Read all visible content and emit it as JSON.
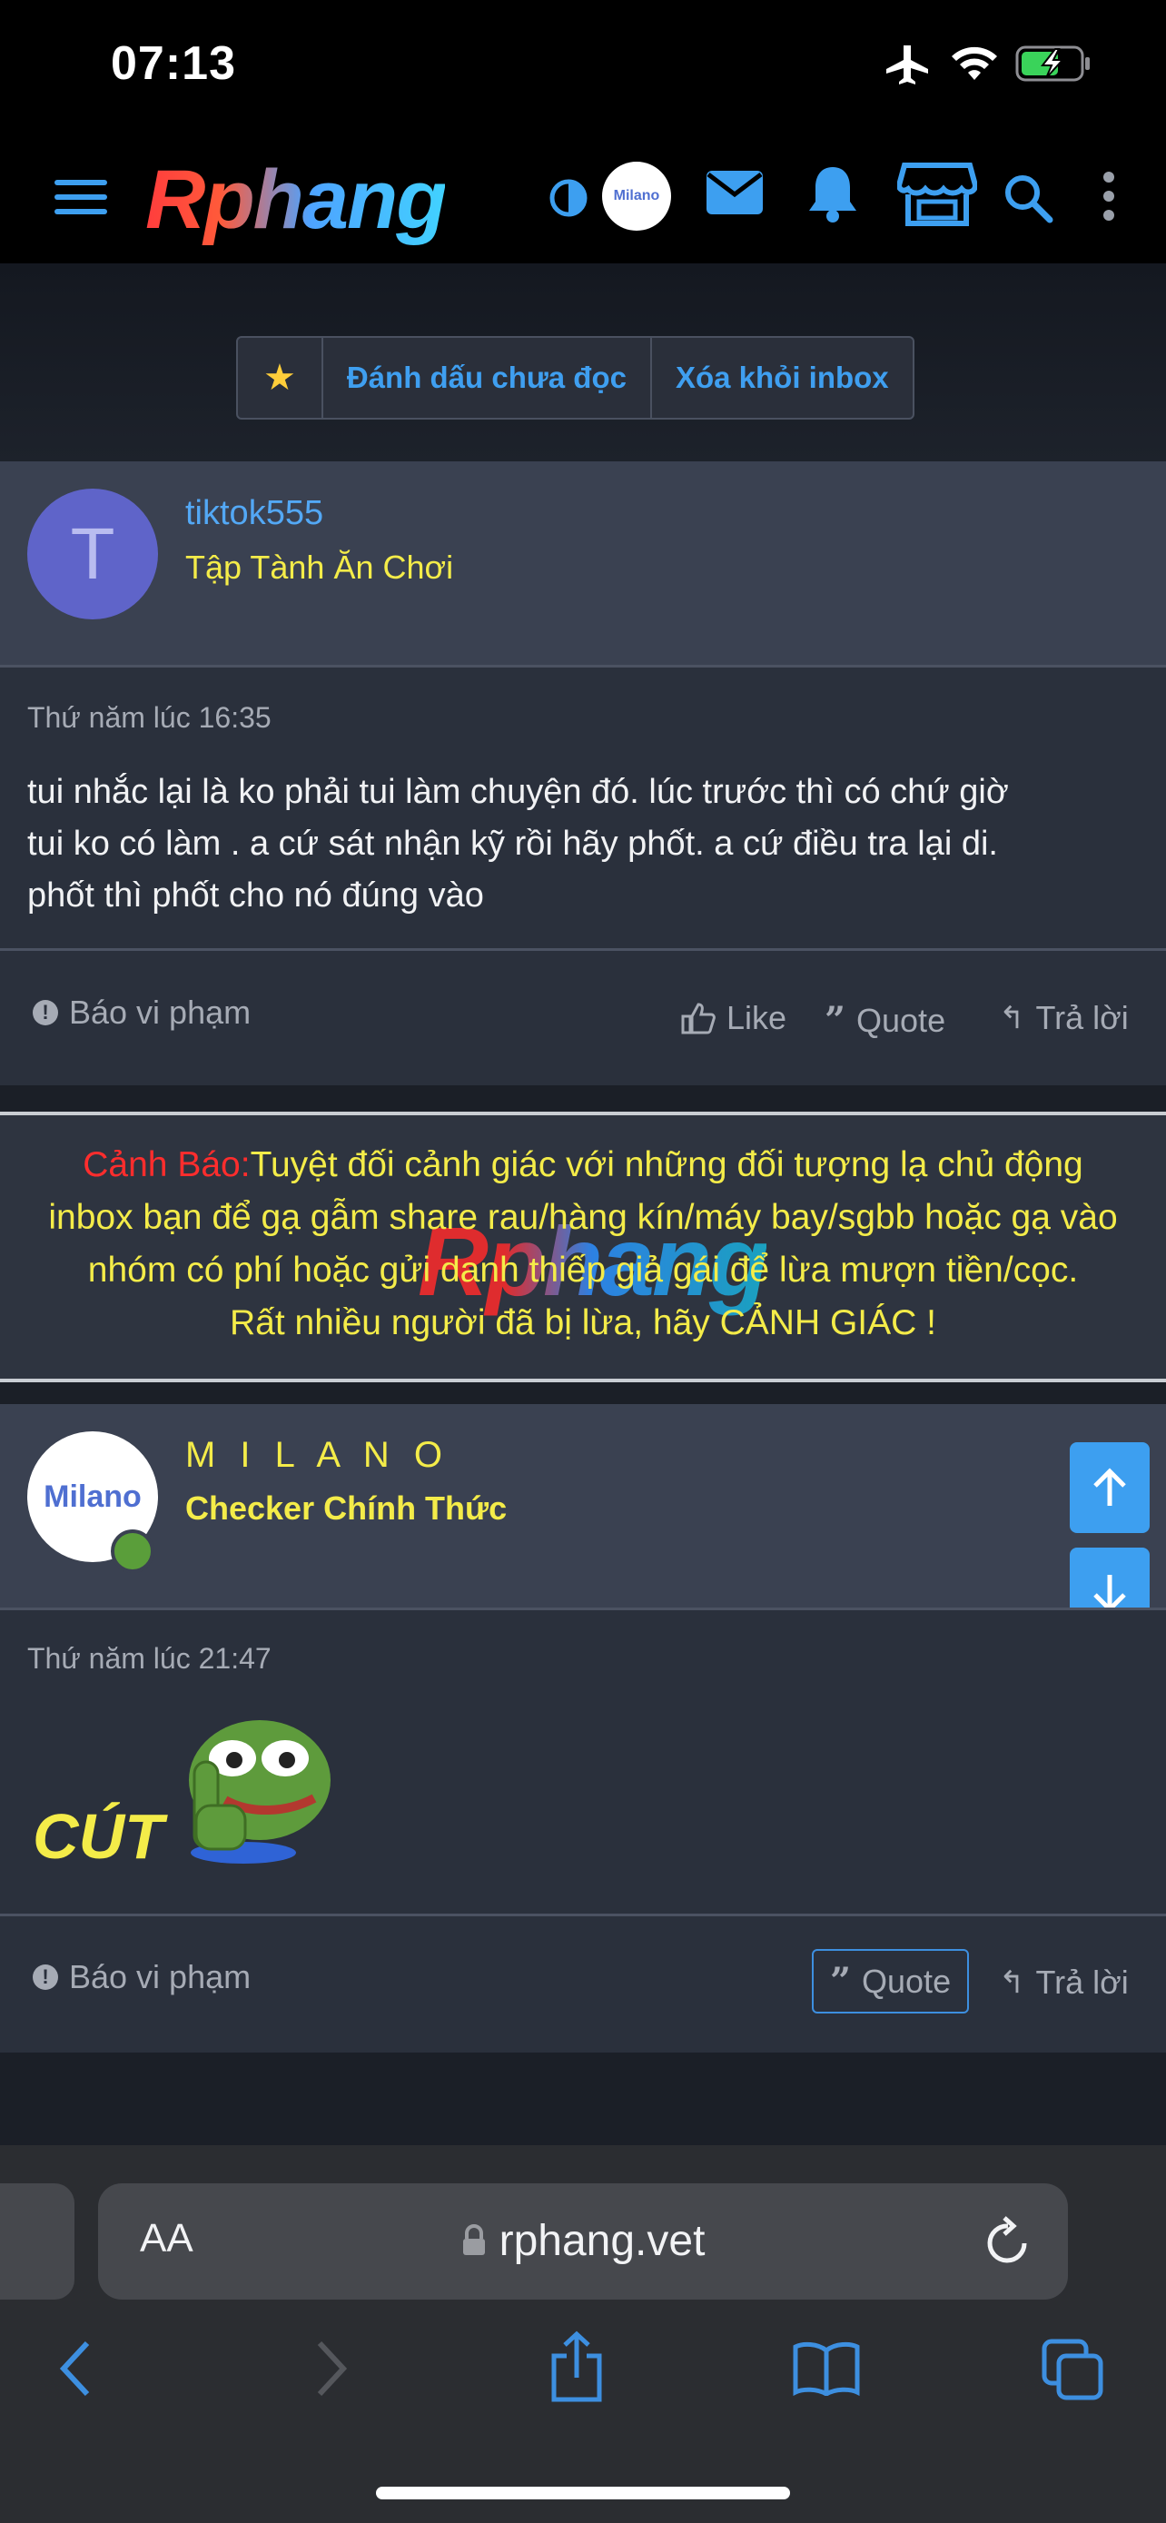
{
  "status": {
    "time": "07:13"
  },
  "header": {
    "logo_text": "Rphang",
    "avatar_text": "Milano"
  },
  "toolbar": {
    "mark_unread": "Đánh dấu chưa đọc",
    "remove_inbox": "Xóa khỏi inbox"
  },
  "posts": [
    {
      "avatar_letter": "T",
      "username": "tiktok555",
      "user_title": "Tập Tành Ăn Chơi",
      "date": "Thứ năm lúc 16:35",
      "text_lines": [
        "tui nhắc lại là ko phải tui làm chuyện đó. lúc trước thì có chứ giờ",
        "tui ko có làm . a cứ sát nhận kỹ rồi hãy phốt. a cứ điều tra lại di.",
        "phốt thì phốt cho nó đúng vào"
      ],
      "report": "Báo vi phạm",
      "like": "Like",
      "quote": "Quote",
      "reply": "Trả lời"
    },
    {
      "avatar_text": "Milano",
      "username": "M I L A N O",
      "user_title": "Checker Chính Thức",
      "date": "Thứ năm lúc 21:47",
      "sticker_text": "CÚT",
      "report": "Báo vi phạm",
      "quote": "Quote",
      "reply": "Trả lời"
    }
  ],
  "warning": {
    "label": "Cảnh Báo:",
    "line1": "Tuyệt đối cảnh giác với những đối tượng lạ chủ động",
    "line2": "inbox bạn để gạ gẫm share rau/hàng kín/máy bay/sgbb hoặc gạ vào",
    "line3": "nhóm có phí hoặc gửi danh thiếp giả gái để lừa mượn tiền/cọc.",
    "line4": "Rất nhiều người đã bị lừa, hãy CẢNH GIÁC !",
    "watermark": "Rphang"
  },
  "browser": {
    "aa": "AA",
    "url": "rphang.vet"
  },
  "colors": {
    "accent": "#53a8f5",
    "title_yellow": "#f4ec49",
    "warning_red": "#ff2d2d",
    "avatar_purple": "#5f64c9"
  }
}
